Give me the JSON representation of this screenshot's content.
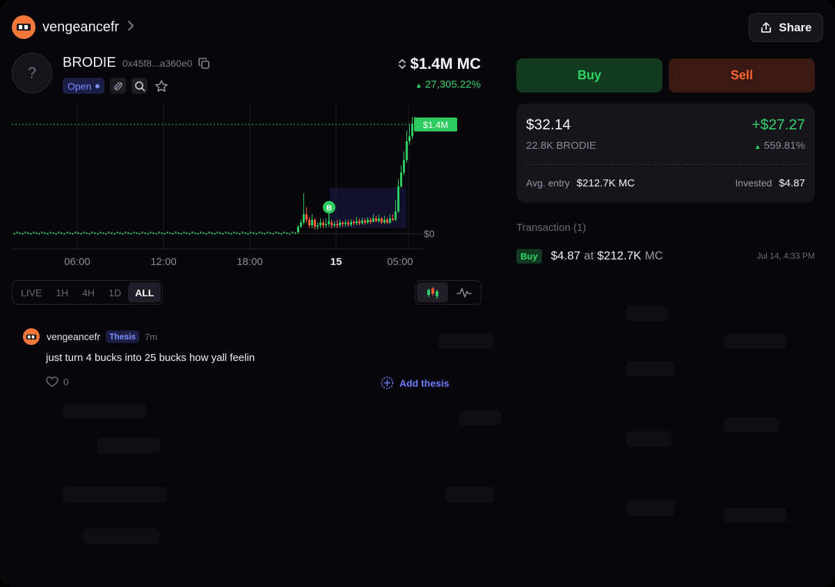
{
  "header": {
    "username": "vengeancefr",
    "share_label": "Share"
  },
  "token": {
    "avatar_placeholder": "?",
    "name": "BRODIE",
    "address": "0x45f8...a360e0",
    "status": "Open",
    "market_cap": "$1.4M MC",
    "change": "27,305.22%"
  },
  "timeframes": [
    "LIVE",
    "1H",
    "4H",
    "1D",
    "ALL"
  ],
  "active_timeframe": "ALL",
  "chart_data": {
    "type": "candlestick",
    "x_ticks": [
      "06:00",
      "12:00",
      "18:00",
      "15",
      "05:00"
    ],
    "y_labels": [
      "$1.4M",
      "$0"
    ],
    "current_price_label": "$1.4M",
    "markers": [
      {
        "label": "B",
        "position": "buy"
      }
    ],
    "colors": {
      "up": "#2ecc5f",
      "down": "#ff5a3a",
      "price_line": "#2ecc5f"
    }
  },
  "thesis": {
    "username": "vengeancefr",
    "badge": "Thesis",
    "time": "7m",
    "text": "just turn 4 bucks into 25 bucks how yall feelin",
    "likes": "0",
    "add_label": "Add thesis"
  },
  "trade": {
    "buy_label": "Buy",
    "sell_label": "Sell"
  },
  "position": {
    "value": "$32.14",
    "amount": "22.8K BRODIE",
    "pnl": "+$27.27",
    "pnl_pct": "559.81%",
    "entry_label": "Avg. entry",
    "entry_value": "$212.7K MC",
    "invested_label": "Invested",
    "invested_value": "$4.87"
  },
  "transactions": {
    "title": "Transaction (1)",
    "items": [
      {
        "type": "Buy",
        "amount": "$4.87",
        "at": "at",
        "mc": "$212.7K",
        "mc_label": "MC",
        "time": "Jul 14, 4:33 PM"
      }
    ]
  },
  "colors": {
    "green": "#32d26a",
    "red": "#ff6433",
    "accent": "#7f8dff",
    "brand": "#f2763a"
  }
}
